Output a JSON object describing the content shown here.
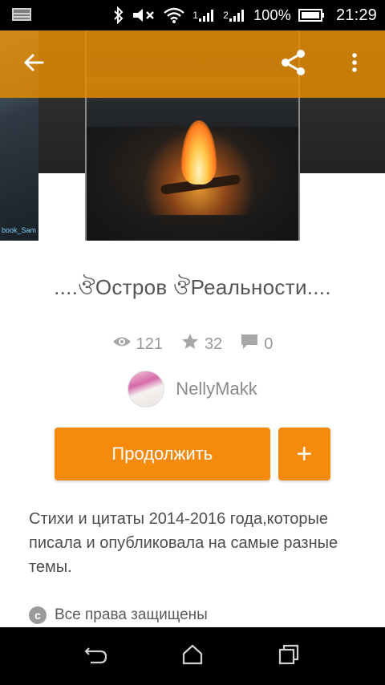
{
  "status_bar": {
    "network_1": "1",
    "network_2": "2",
    "battery": "100%",
    "time": "21:29"
  },
  "story": {
    "title": "....ঔОстров ঔРеальности....",
    "stats": {
      "views": "121",
      "votes": "32",
      "comments": "0"
    },
    "author": "NellyMakk",
    "description": "Стихи и цитаты 2014-2016 года,которые писала и опубликовала на самые разные темы.",
    "rights": "Все права защищены",
    "cover_side_tag": "book_Sam"
  },
  "actions": {
    "continue_label": "Продолжить",
    "add_label": "+"
  },
  "icons": {
    "back": "arrow-back-icon",
    "share": "share-icon",
    "more": "more-vert-icon",
    "views": "eye-icon",
    "votes": "star-icon",
    "comments": "comment-icon",
    "copyright": "copyright-icon"
  },
  "colors": {
    "accent": "#f58a0b",
    "appbar_overlay": "#e88c00",
    "stat_gray": "#9a9a9a"
  }
}
